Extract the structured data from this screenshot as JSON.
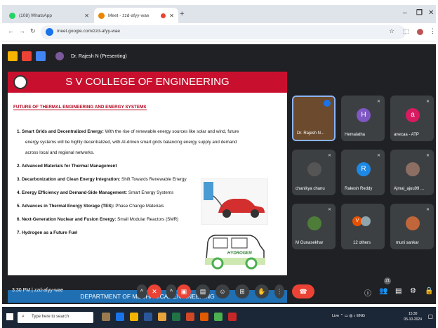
{
  "browser": {
    "tabs": [
      {
        "label": "(108) WhatsApp",
        "color": "#25d366"
      },
      {
        "label": "Meet - zzd-afyy-wae",
        "color": "#ea8600"
      }
    ],
    "url": "meet.google.com/zzd-afyy-wae"
  },
  "presenter": {
    "label": "Dr. Rajesh N (Presenting)"
  },
  "slide": {
    "title": "S V COLLEGE OF ENGINEERING",
    "subtitle": "FUTURE OF THERMAL ENGINEERING AND ENERGY SYSTEMS",
    "points": [
      {
        "head": "1. Smart Grids and Decentralized Energy:",
        "text": " With the rise of renewable energy sources like solar and wind, future"
      },
      {
        "head": "",
        "text": "energy systems will be highly decentralized, with AI-driven smart grids balancing energy supply and demand"
      },
      {
        "head": "",
        "text": "across local and regional networks."
      },
      {
        "head": "2. Advanced Materials for Thermal Management",
        "text": ""
      },
      {
        "head": "3. Decarbonization and Clean Energy Integration:",
        "text": " Shift Towards Renewable Energy"
      },
      {
        "head": "4. Energy Efficiency and Demand-Side Management:",
        "text": " Smart Energy Systems"
      },
      {
        "head": "5. Advances in Thermal Energy Storage (TES):",
        "text": " Phase Change Materials"
      },
      {
        "head": "6. Next-Generation Nuclear and Fusion Energy:",
        "text": " Small Modular Reactors (SMR)"
      },
      {
        "head": "7. Hydrogen as a Future Fuel",
        "text": ""
      }
    ],
    "car_label": "HYDROGEN",
    "footer": "DEPARTMENT OF MECHANICAL ENGINEERING"
  },
  "participants": [
    {
      "name": "Dr. Rajesh N...",
      "initial": "",
      "color": "#6b4a2d"
    },
    {
      "name": "Hemalatha",
      "initial": "H",
      "color": "#7e57c2"
    },
    {
      "name": "anecaa - ATP",
      "initial": "a",
      "color": "#d81b60"
    },
    {
      "name": "chanikya chanu",
      "initial": "",
      "color": "#555555"
    },
    {
      "name": "Rakesh Reddy",
      "initial": "R",
      "color": "#1e88e5"
    },
    {
      "name": "Ajmal_ajuu99 ...",
      "initial": "",
      "color": "#8d6e63"
    },
    {
      "name": "M Gunasekhar",
      "initial": "",
      "color": "#4e7d3a"
    },
    {
      "name": "12 others",
      "initial": "V",
      "color": "#e65100"
    },
    {
      "name": "muni sankar",
      "initial": "",
      "color": "#c0663a"
    }
  ],
  "bottom": {
    "time_label": "3:30 PM  |  zzd-afyy-wae",
    "participant_count": "21"
  },
  "taskbar": {
    "search_placeholder": "Type here to search",
    "tray_text": "Live",
    "lang": "ENG",
    "clock_time": "15:30",
    "clock_date": "05-10-2024"
  }
}
